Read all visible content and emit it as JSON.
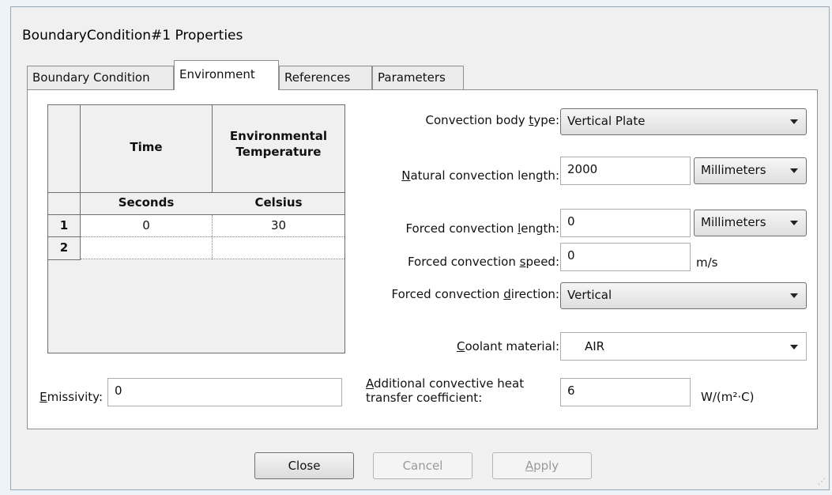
{
  "window": {
    "title": "BoundaryCondition#1 Properties"
  },
  "tabs": [
    {
      "label": "Boundary Condition"
    },
    {
      "label": "Environment"
    },
    {
      "label": "References"
    },
    {
      "label": "Parameters"
    }
  ],
  "table": {
    "col_time": "Time",
    "col_env_line1": "Environmental",
    "col_env_line2": "Temperature",
    "unit_time": "Seconds",
    "unit_env": "Celsius",
    "rows": [
      {
        "index": "1",
        "time": "0",
        "temp": "30"
      },
      {
        "index": "2",
        "time": "",
        "temp": ""
      }
    ]
  },
  "emissivity": {
    "label_first": "E",
    "label_rest": "missivity:",
    "value": "0"
  },
  "convection_body_type": {
    "label_pre": "Convection body ",
    "label_key": "t",
    "label_post": "ype:",
    "value": "Vertical Plate"
  },
  "natural_length": {
    "label_key": "N",
    "label_rest": "atural convection length:",
    "value": "2000",
    "unit": "Millimeters"
  },
  "forced_length": {
    "label_pre": "Forced convection ",
    "label_key": "l",
    "label_post": "ength:",
    "value": "0",
    "unit": "Millimeters"
  },
  "forced_speed": {
    "label_pre": "Forced convection ",
    "label_key": "s",
    "label_post": "peed:",
    "value": "0",
    "unit": "m/s"
  },
  "forced_direction": {
    "label_pre": "Forced convection ",
    "label_key": "d",
    "label_post": "irection:",
    "value": "Vertical"
  },
  "coolant": {
    "label_key": "C",
    "label_rest": "oolant material:",
    "value": "AIR"
  },
  "additional_coeff": {
    "label_key": "A",
    "label_line1_rest": "dditional convective heat",
    "label_line2": "transfer coefficient:",
    "value": "6",
    "unit": "W/(m²·C)"
  },
  "buttons": {
    "close": "Close",
    "cancel": "Cancel",
    "apply_key": "A",
    "apply_rest": "pply"
  }
}
